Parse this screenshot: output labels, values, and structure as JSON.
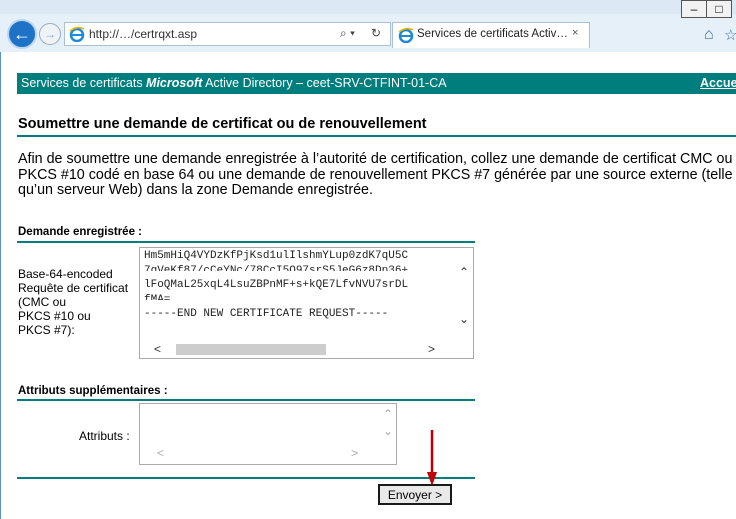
{
  "browser": {
    "address_url": "http://…/certrqxt.asp",
    "tab_title": "Services de certificats Activ…",
    "tab_close": "×",
    "search_glyph": "⌕ ▾",
    "refresh_glyph": "↻",
    "back_glyph": "←",
    "forward_glyph": "→",
    "window_minimize": "–",
    "window_maximize": "□"
  },
  "banner": {
    "prefix": "Services de certificats ",
    "brand": "Microsoft",
    "suffix": " Active Directory  –  ceet-SRV-CTFINT-01-CA",
    "home_link": "Accue"
  },
  "page": {
    "title": "Soumettre une demande de certificat ou de renouvellement",
    "intro": "Afin de soumettre une demande enregistrée à l’autorité de certification, collez une demande de certificat CMC ou PKCS #10 codé en base 64 ou une demande de renouvellement PKCS #7 générée par une source externe (telle qu’un serveur Web) dans la zone Demande enregistrée."
  },
  "saved_request": {
    "section_title": "Demande enregistrée :",
    "label_lines": [
      "Base-64-encoded",
      "Requête de certificat",
      "(CMC ou",
      "PKCS #10 ou",
      "PKCS #7):"
    ],
    "textarea_lines": [
      "Hm5mHiQ4VYDzKfPjKsd1ulIlshmYLup0zdK7qU5C",
      "7gVeKf87/cCeYNc/78CcI5O97srS5JeG6z8Dp36+",
      "lFoQMaL25xqL4LsuZBPnMF+s+kQE7LfvNVU7srDL",
      "fMA=",
      "-----END NEW CERTIFICATE REQUEST-----"
    ]
  },
  "extra_attributes": {
    "section_title": "Attributs supplémentaires :",
    "label": "Attributs :"
  },
  "submit_label": "Envoyer >"
}
